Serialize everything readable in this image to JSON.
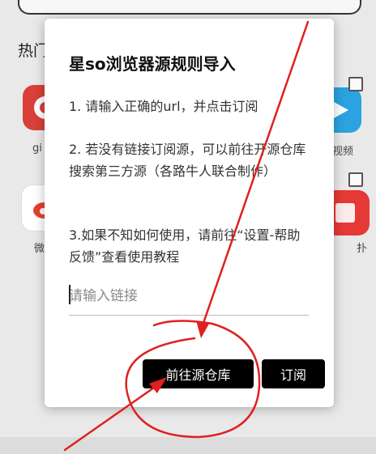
{
  "background": {
    "section_title": "热门",
    "apps": [
      {
        "label": "gi",
        "color": "#d9403a"
      },
      {
        "label": "视频",
        "color": "#2aa3e0"
      },
      {
        "label": "微",
        "color": "#e6402f"
      },
      {
        "label": "扑",
        "color": "#e53935"
      }
    ]
  },
  "dialog": {
    "title": "星so浏览器源规则导入",
    "step1": "1. 请输入正确的url，并点击订阅",
    "step2": "2. 若没有链接订阅源，可以前往开源仓库搜索第三方源（各路牛人联合制作）",
    "step3": "3.如果不知如何使用，请前往“设置-帮助反馈”查看使用教程",
    "input_placeholder": "请输入链接",
    "repo_button": "前往源仓库",
    "subscribe_button": "订阅"
  },
  "annotation_color": "#e02020"
}
